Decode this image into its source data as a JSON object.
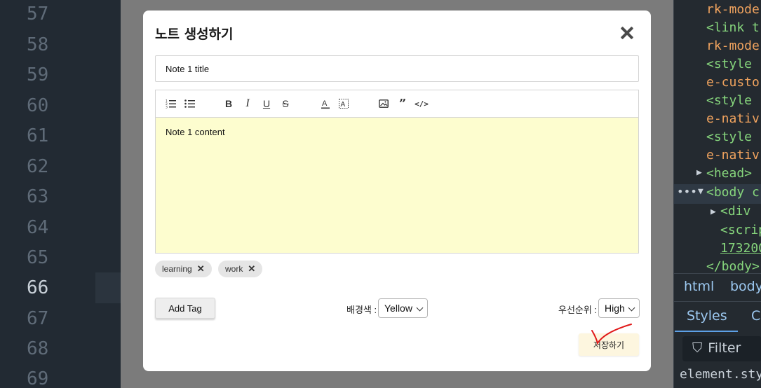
{
  "editor_gutter": {
    "line_numbers": [
      "57",
      "58",
      "59",
      "60",
      "61",
      "62",
      "63",
      "64",
      "65",
      "66",
      "67",
      "68",
      "69"
    ]
  },
  "modal": {
    "title": "노트 생성하기",
    "title_input_value": "Note 1 title",
    "content": "Note 1 content",
    "tags": [
      {
        "label": "learning"
      },
      {
        "label": "work"
      }
    ],
    "add_tag_label": "Add Tag",
    "bg_color_label": "배경색 :",
    "bg_color_value": "Yellow",
    "priority_label": "우선순위 :",
    "priority_value": "High",
    "save_label": "저장하기",
    "editor_bg_color": "#fdfdcf",
    "toolbar_icons": [
      "ordered-list-icon",
      "bullet-list-icon",
      "bold-icon",
      "italic-icon",
      "underline-icon",
      "strikethrough-icon",
      "text-color-icon",
      "background-color-icon",
      "image-icon",
      "blockquote-icon",
      "code-icon"
    ]
  },
  "devtools": {
    "lines": [
      {
        "text": "rk-mode"
      },
      {
        "text": "<link t"
      },
      {
        "text": "rk-mode"
      },
      {
        "text": "<style"
      },
      {
        "text": "e-custo"
      },
      {
        "text": "<style"
      },
      {
        "text": "e-nativ"
      },
      {
        "text": "<style"
      },
      {
        "text": "e-nativ"
      },
      {
        "text": "<head>"
      },
      {
        "text": "<body c"
      },
      {
        "text": "<div"
      },
      {
        "text": "<scrip"
      },
      {
        "text": "173200"
      },
      {
        "text": "</body>"
      }
    ],
    "breadcrumbs": [
      "html",
      "body"
    ],
    "tabs": [
      "Styles",
      "C"
    ],
    "filter_label": "Filter",
    "element_style": "element.sty"
  }
}
